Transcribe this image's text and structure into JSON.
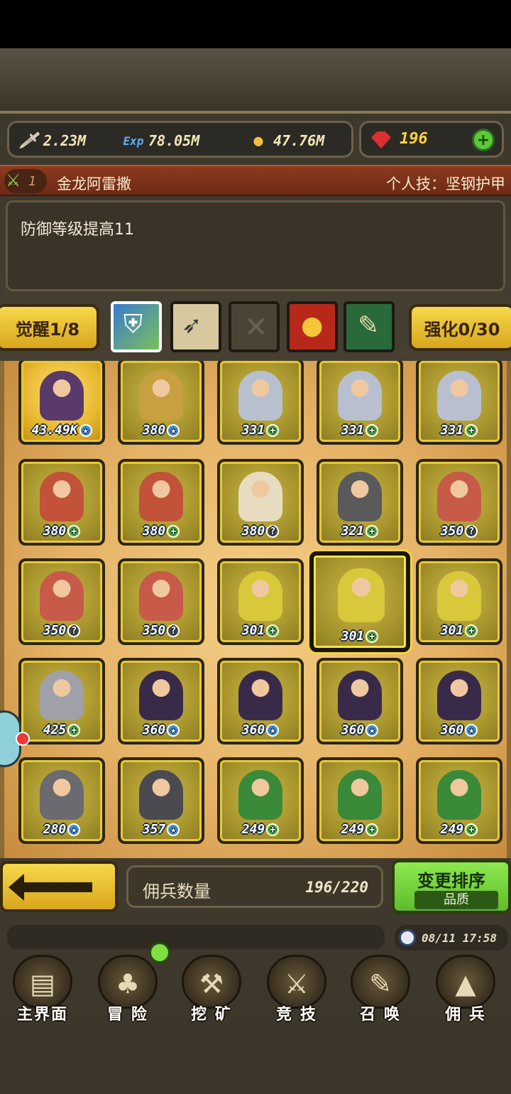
{
  "currency": {
    "attack": "2.23M",
    "exp": "78.05M",
    "gold": "47.76M",
    "gems": "196"
  },
  "skill": {
    "level": "1",
    "name": "金龙阿雷撒",
    "personal_skill": "个人技：坚钢护甲",
    "description": "防御等级提高11"
  },
  "awaken": {
    "awaken_label": "觉醒1/8",
    "enhance_label": "强化0/30"
  },
  "mercenaries": [
    {
      "value": "43.49K",
      "badge": "★",
      "color": "#5a3a6a"
    },
    {
      "value": "380",
      "badge": "★",
      "color": "#c9a040"
    },
    {
      "value": "331",
      "badge": "+",
      "color": "#b8c0d0"
    },
    {
      "value": "331",
      "badge": "+",
      "color": "#b8c0d0"
    },
    {
      "value": "331",
      "badge": "+",
      "color": "#b8c0d0"
    },
    {
      "value": "380",
      "badge": "+",
      "color": "#c2523a"
    },
    {
      "value": "380",
      "badge": "+",
      "color": "#c2523a"
    },
    {
      "value": "380",
      "badge": "?",
      "color": "#e8dcc0"
    },
    {
      "value": "321",
      "badge": "+",
      "color": "#5a5a5a"
    },
    {
      "value": "350",
      "badge": "?",
      "color": "#c85a4a"
    },
    {
      "value": "350",
      "badge": "?",
      "color": "#c85a4a"
    },
    {
      "value": "350",
      "badge": "?",
      "color": "#c85a4a"
    },
    {
      "value": "301",
      "badge": "+",
      "color": "#d8c83a"
    },
    {
      "value": "301",
      "badge": "+",
      "color": "#d8c83a"
    },
    {
      "value": "301",
      "badge": "+",
      "color": "#d8c83a"
    },
    {
      "value": "425",
      "badge": "+",
      "color": "#a0a0a8"
    },
    {
      "value": "360",
      "badge": "★",
      "color": "#3a2a4a"
    },
    {
      "value": "360",
      "badge": "★",
      "color": "#3a2a4a"
    },
    {
      "value": "360",
      "badge": "★",
      "color": "#3a2a4a"
    },
    {
      "value": "360",
      "badge": "★",
      "color": "#3a2a4a"
    },
    {
      "value": "280",
      "badge": "★",
      "color": "#6a6a70"
    },
    {
      "value": "357",
      "badge": "★",
      "color": "#4a4a50"
    },
    {
      "value": "249",
      "badge": "+",
      "color": "#3a8a3a"
    },
    {
      "value": "249",
      "badge": "+",
      "color": "#3a8a3a"
    },
    {
      "value": "249",
      "badge": "+",
      "color": "#3a8a3a"
    }
  ],
  "bottom": {
    "count_label": "佣兵数量",
    "count_value": "196/220",
    "sort_title": "变更排序",
    "sort_sub": "品质",
    "clock": "08/11 17:58"
  },
  "nav": [
    {
      "label": "主界面",
      "icon": "map-scroll-icon",
      "glyph": "▤"
    },
    {
      "label": "冒 险",
      "icon": "island-icon",
      "glyph": "♣"
    },
    {
      "label": "挖 矿",
      "icon": "pickaxe-icon",
      "glyph": "⚒"
    },
    {
      "label": "竞 技",
      "icon": "crossed-swords-icon",
      "glyph": "⚔"
    },
    {
      "label": "召 唤",
      "icon": "scroll-icon",
      "glyph": "✎"
    },
    {
      "label": "佣 兵",
      "icon": "tent-icon",
      "glyph": "▲"
    }
  ]
}
